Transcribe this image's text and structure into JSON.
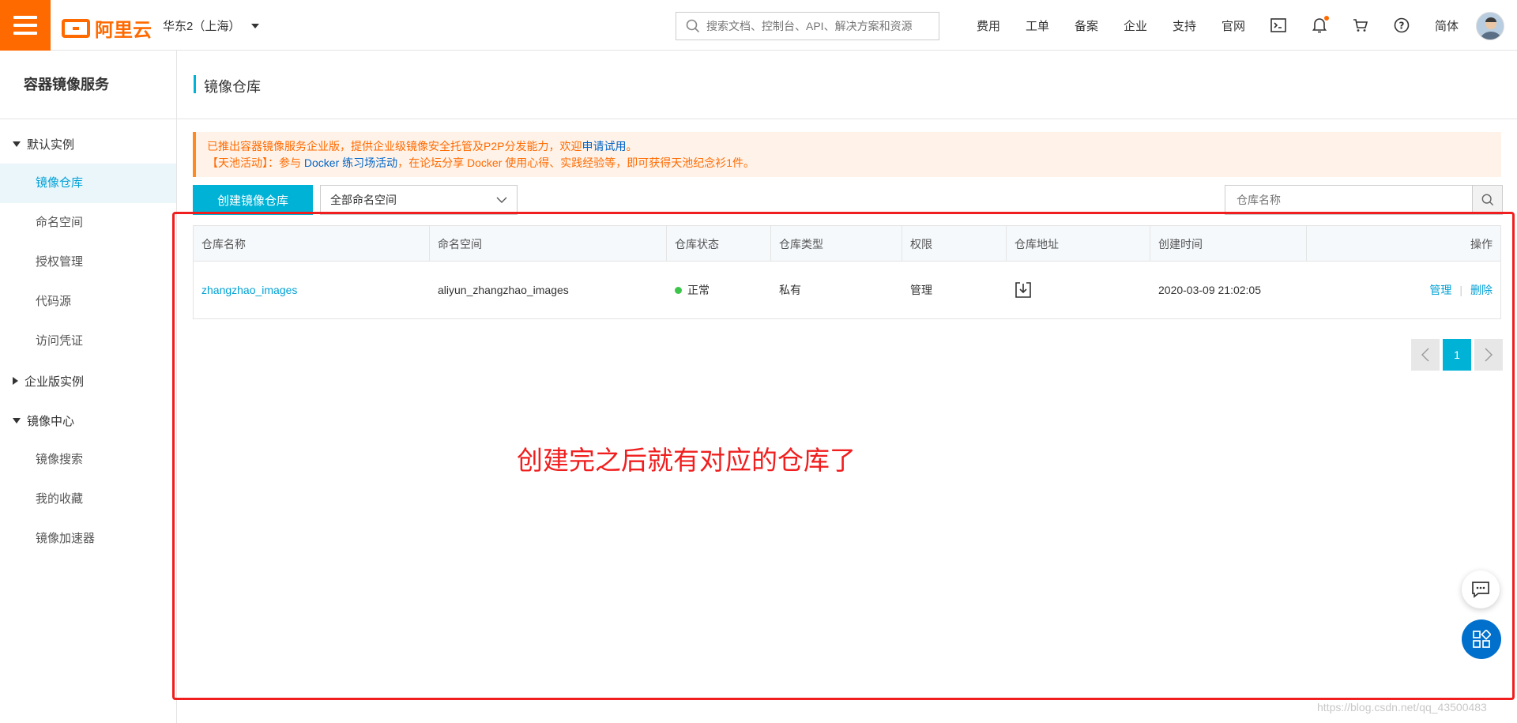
{
  "brand": {
    "logo_text": "阿里云"
  },
  "header": {
    "region": "华东2（上海）",
    "search_placeholder": "搜索文档、控制台、API、解决方案和资源",
    "links": [
      "费用",
      "工单",
      "备案",
      "企业",
      "支持",
      "官网"
    ],
    "lang": "简体",
    "accent": "#ff6a00"
  },
  "sidebar": {
    "title": "容器镜像服务",
    "group1": "默认实例",
    "group1_items": [
      "镜像仓库",
      "命名空间",
      "授权管理",
      "代码源",
      "访问凭证"
    ],
    "group2": "企业版实例",
    "group3": "镜像中心",
    "group3_items": [
      "镜像搜索",
      "我的收藏",
      "镜像加速器"
    ]
  },
  "page": {
    "title": "镜像仓库"
  },
  "notice": {
    "line1_prefix": "已推出容器镜像服务企业版，提供企业级镜像安全托管及P2P分发能力，欢迎",
    "line1_link": "申请试用",
    "line1_suffix": "。",
    "line2_prefix": "【天池活动】：参与 ",
    "line2_link": "Docker 练习场活动",
    "line2_suffix": "，在论坛分享 Docker 使用心得、实践经验等，即可获得天池纪念衫1件。"
  },
  "toolbar": {
    "create_label": "创建镜像仓库",
    "namespace_select": "全部命名空间",
    "repo_search_placeholder": "仓库名称"
  },
  "table": {
    "headers": [
      "仓库名称",
      "命名空间",
      "仓库状态",
      "仓库类型",
      "权限",
      "仓库地址",
      "创建时间",
      "操作"
    ],
    "rows": [
      {
        "name": "zhangzhao_images",
        "namespace": "aliyun_zhangzhao_images",
        "status": "正常",
        "type": "私有",
        "permission": "管理",
        "created": "2020-03-09 21:02:05",
        "action_manage": "管理",
        "action_sep": "|",
        "action_delete": "删除"
      }
    ]
  },
  "pagination": {
    "current": "1"
  },
  "annotation": {
    "text": "创建完之后就有对应的仓库了",
    "color": "#f01e1e"
  },
  "watermark": "https://blog.csdn.net/qq_43500483"
}
